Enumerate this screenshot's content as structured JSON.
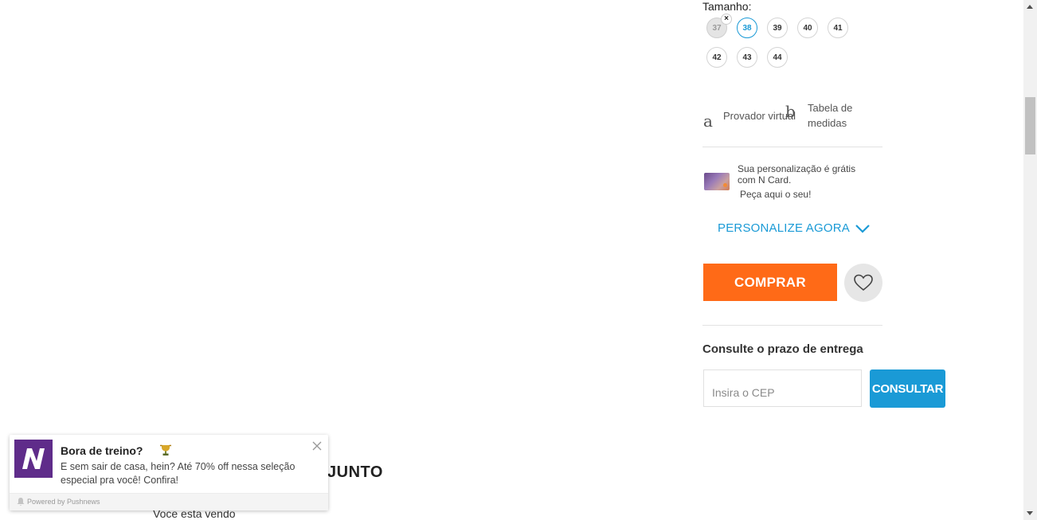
{
  "size": {
    "label": "Tamanho:",
    "options": [
      {
        "value": "37",
        "state": "unavailable"
      },
      {
        "value": "38",
        "state": "selected"
      },
      {
        "value": "39",
        "state": "available"
      },
      {
        "value": "40",
        "state": "available"
      },
      {
        "value": "41",
        "state": "available"
      },
      {
        "value": "42",
        "state": "available"
      },
      {
        "value": "43",
        "state": "available"
      },
      {
        "value": "44",
        "state": "available"
      }
    ],
    "unavailable_mark": "×"
  },
  "tools": {
    "virtual_fitting_glyph": "a",
    "virtual_fitting_label": "Provador virtual",
    "size_chart_glyph": "b",
    "size_chart_label_line1": "Tabela de",
    "size_chart_label_line2": "medidas"
  },
  "ncard": {
    "line1": "Sua personalização é grátis",
    "line2": " com N Card.",
    "line3": "Peça aqui o seu!"
  },
  "personalize": {
    "label": "PERSONALIZE AGORA",
    "icon": "chevron-down-icon"
  },
  "actions": {
    "buy_label": "COMPRAR",
    "wishlist_icon": "heart-icon"
  },
  "shipping": {
    "title": "Consulte o prazo de entrega",
    "placeholder": "Insira o CEP",
    "button_label": "CONSULTAR"
  },
  "section": {
    "heading": "JUNTO",
    "subtitle": "Voce esta vendo"
  },
  "push": {
    "title": "Bora de treino?",
    "emoji_icon": "trophy-icon",
    "body": "E sem sair de casa, hein? Até 70% off nessa seleção especial pra você! Confira!",
    "footer": "Powered by Pushnews"
  },
  "colors": {
    "accent_blue": "#1a9ad6",
    "buy_orange": "#ff6a17",
    "push_brand": "#5f2c8a"
  }
}
